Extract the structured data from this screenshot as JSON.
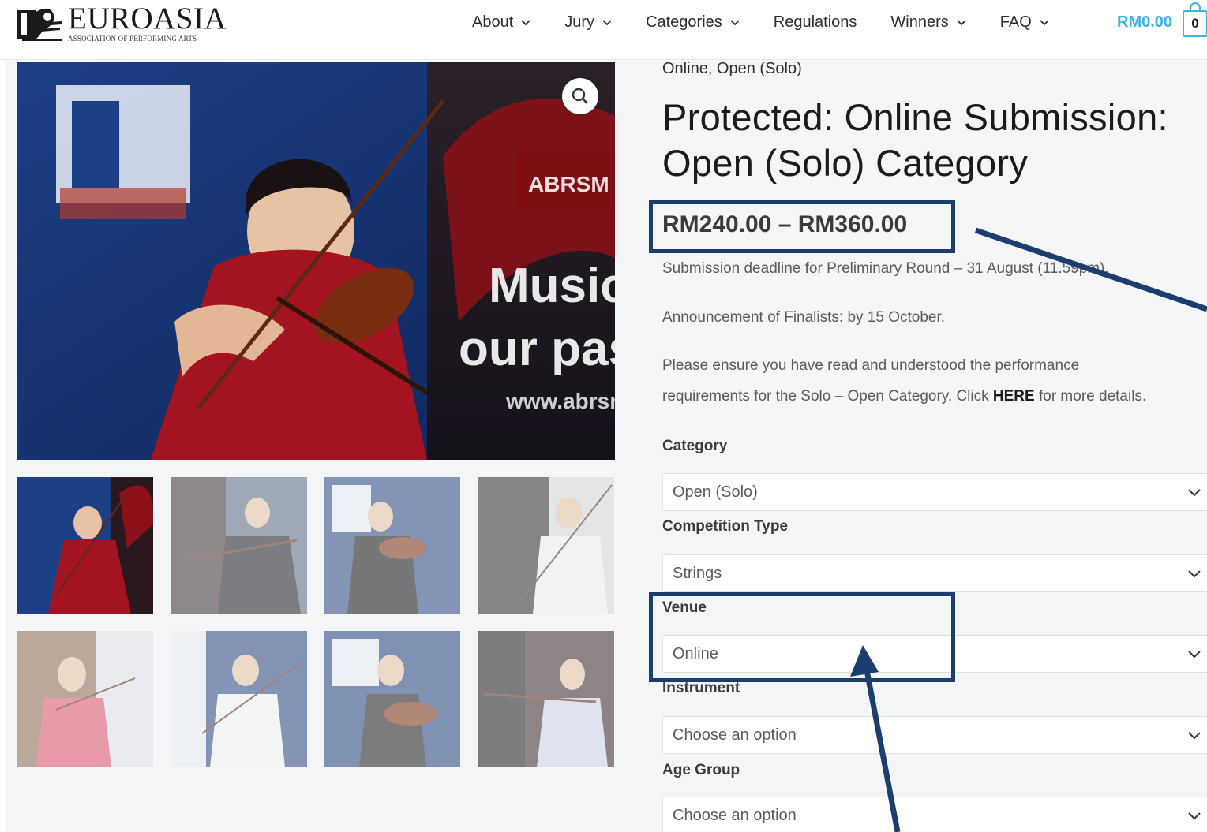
{
  "header": {
    "logo": {
      "word": "EUROASIA",
      "subtitle": "ASSOCIATION OF PERFORMING ARTS"
    },
    "nav": [
      {
        "label": "About",
        "dropdown": true
      },
      {
        "label": "Jury",
        "dropdown": true
      },
      {
        "label": "Categories",
        "dropdown": true
      },
      {
        "label": "Regulations",
        "dropdown": false
      },
      {
        "label": "Winners",
        "dropdown": true
      },
      {
        "label": "FAQ",
        "dropdown": true
      }
    ],
    "cart": {
      "total": "RM0.00",
      "count": "0",
      "accent_color": "#39b4e6"
    }
  },
  "gallery": {
    "main_image": {
      "icon": "zoom-search-icon",
      "alt": "violinist-performing"
    },
    "thumbnails": 8
  },
  "product": {
    "categories_line": "Online, Open (Solo)",
    "title_line1": "Protected: Online Submission:",
    "title_line2": "Open (Solo) Category",
    "price": "RM240.00 – RM360.00",
    "description": {
      "deadline": "Submission deadline for Preliminary Round – 31 August (11.59pm).",
      "announcement": "Announcement of Finalists: by 15 October.",
      "requirements_line1": "Please ensure you have read and understood the performance",
      "requirements_line2_pre": "requirements for the Solo – Open Category. Click ",
      "requirements_link": "HERE",
      "requirements_line2_post": " for more details."
    }
  },
  "form": {
    "category": {
      "label": "Category",
      "value": "Open (Solo)"
    },
    "competition_type": {
      "label": "Competition Type",
      "value": "Strings"
    },
    "venue": {
      "label": "Venue",
      "value": "Online"
    },
    "instrument": {
      "label": "Instrument",
      "value": "Choose an option"
    },
    "age_group": {
      "label": "Age Group",
      "value": "Choose an option"
    }
  },
  "annotation_color": "#1b3e6e"
}
